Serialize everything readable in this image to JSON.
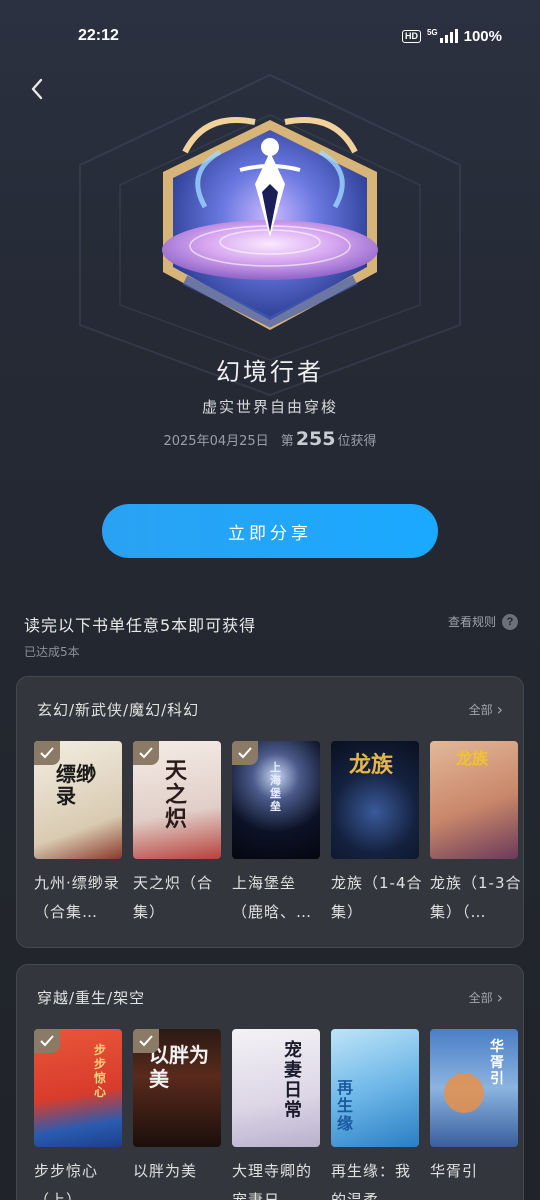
{
  "status": {
    "time": "22:12",
    "hd": "HD",
    "network": "5G",
    "battery": "100%"
  },
  "nav": {
    "back_icon": "chevron-left-icon"
  },
  "badge": {
    "title": "幻境行者",
    "desc": "虚实世界自由穿梭",
    "date": "2025年04月25日",
    "rank_prefix": "第",
    "rank": "255",
    "rank_suffix": "位获得"
  },
  "share": {
    "label": "立即分享"
  },
  "task": {
    "title": "读完以下书单任意5本即可获得",
    "progress": "已达成5本",
    "rules_label": "查看规则",
    "rules_icon": "?"
  },
  "categories": [
    {
      "title": "玄幻/新武侠/魔幻/科幻",
      "see_all": "全部",
      "see_all_icon": "›",
      "books": [
        {
          "name": "九州·缥缈录（合集…",
          "cover_text": "缥缈录",
          "done": true
        },
        {
          "name": "天之炽（合集）",
          "cover_text": "天之炽",
          "done": true
        },
        {
          "name": "上海堡垒（鹿晗、…",
          "cover_text": "上海堡垒",
          "done": true
        },
        {
          "name": "龙族（1-4合集）",
          "cover_text": "龙族",
          "done": false
        },
        {
          "name": "龙族（1-3合集）（…",
          "cover_text": "龙族",
          "done": false
        }
      ]
    },
    {
      "title": "穿越/重生/架空",
      "see_all": "全部",
      "see_all_icon": "›",
      "books": [
        {
          "name": "步步惊心（上）",
          "cover_text": "步步惊心",
          "done": true
        },
        {
          "name": "以胖为美",
          "cover_text": "以胖为美",
          "done": true
        },
        {
          "name": "大理寺卿的宠妻日…",
          "cover_text": "宠妻日常",
          "done": false
        },
        {
          "name": "再生缘：我的温柔…",
          "cover_text": "再生缘",
          "done": false
        },
        {
          "name": "华胥引",
          "cover_text": "华胥引",
          "done": false
        }
      ]
    }
  ]
}
